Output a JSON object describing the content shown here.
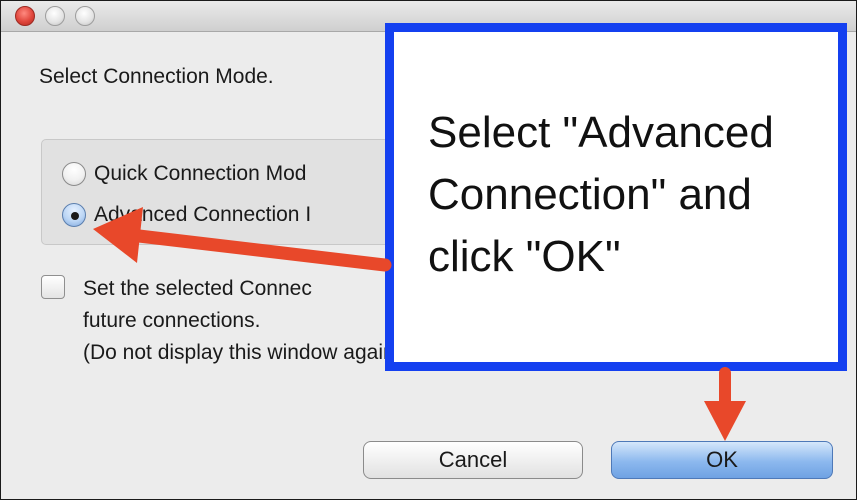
{
  "window": {
    "traffic_lights": [
      "close",
      "minimize",
      "maximize"
    ]
  },
  "dialog": {
    "prompt": "Select Connection Mode.",
    "options": [
      {
        "label": "Quick Connection Mod",
        "selected": false
      },
      {
        "label": "Advanced Connection I",
        "selected": true
      }
    ],
    "checkbox": {
      "checked": false,
      "lines": [
        "Set the selected Connec",
        "future connections.",
        "(Do not display this window again.)"
      ]
    },
    "buttons": {
      "cancel": "Cancel",
      "ok": "OK"
    }
  },
  "callout": {
    "lines": [
      "Select \"Advanced",
      "Connection\" and",
      "click \"OK\""
    ],
    "border_color": "#1440f0"
  },
  "annotations": {
    "arrow_color": "#e8482a",
    "arrows": [
      "arrow-to-advanced-option",
      "arrow-to-ok-button"
    ]
  }
}
